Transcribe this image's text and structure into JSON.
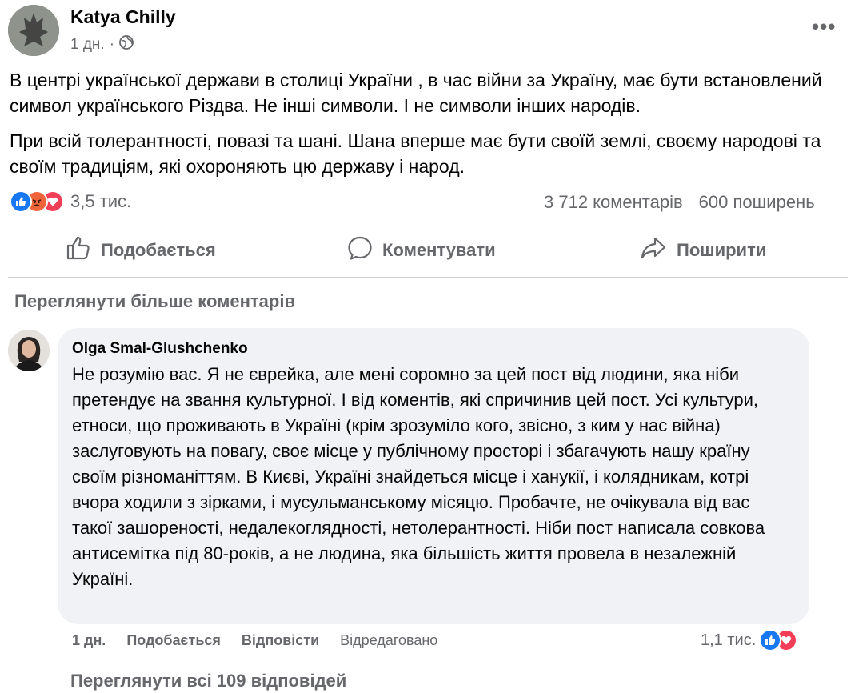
{
  "post": {
    "author": "Katya Chilly",
    "time": "1 дн.",
    "separator": "·",
    "paragraphs": [
      "В центрі української держави в столиці України , в час війни за Україну, має бути встановлений символ українського Різдва. Не інші символи. І не символи інших народів.",
      "При всій толерантності, повазі та шані. Шана вперше має бути своїй землі, своєму народові та своїм традиціям, які охороняють цю державу і народ."
    ],
    "reaction_count": "3,5 тис.",
    "comment_count": "3 712 коментарів",
    "share_count": "600 поширень"
  },
  "actions": {
    "like": "Подобається",
    "comment": "Коментувати",
    "share": "Поширити"
  },
  "view_more_comments": "Переглянути більше коментарів",
  "comment": {
    "author": "Olga Smal-Glushchenko",
    "text": "Не розумію вас. Я не єврейка, але мені соромно за цей пост від людини, яка ніби претендує на звання культурної. І від коментів, які спричинив цей пост. Усі культури, етноси, що проживають в Україні (крім зрозуміло кого, звісно, з ким у нас війна) заслуговують на повагу, своє місце у публічному просторі і збагачують нашу країну своїм різноманіттям. В Києві, Україні знайдеться місце і ханукії, і колядникам, котрі вчора ходили з зірками, і мусульманському місяцю. Пробачте, не очікувала від вас такої зашореності, недалекоглядності, нетолерантності. Ніби пост написала совкова антисемітка під 80-років, а не людина, яка більшість життя провела в незалежній Україні.",
    "time": "1 дн.",
    "like": "Подобається",
    "reply": "Відповісти",
    "edited": "Відредаговано",
    "reaction_count": "1,1 тис."
  },
  "view_replies": "Переглянути всі 109 відповідей",
  "colors": {
    "like_blue": "#1877f2",
    "angry_orange": "#f0643c",
    "love_red": "#f33e58",
    "secondary_text": "#65676b",
    "bubble_bg": "#f0f2f5"
  }
}
